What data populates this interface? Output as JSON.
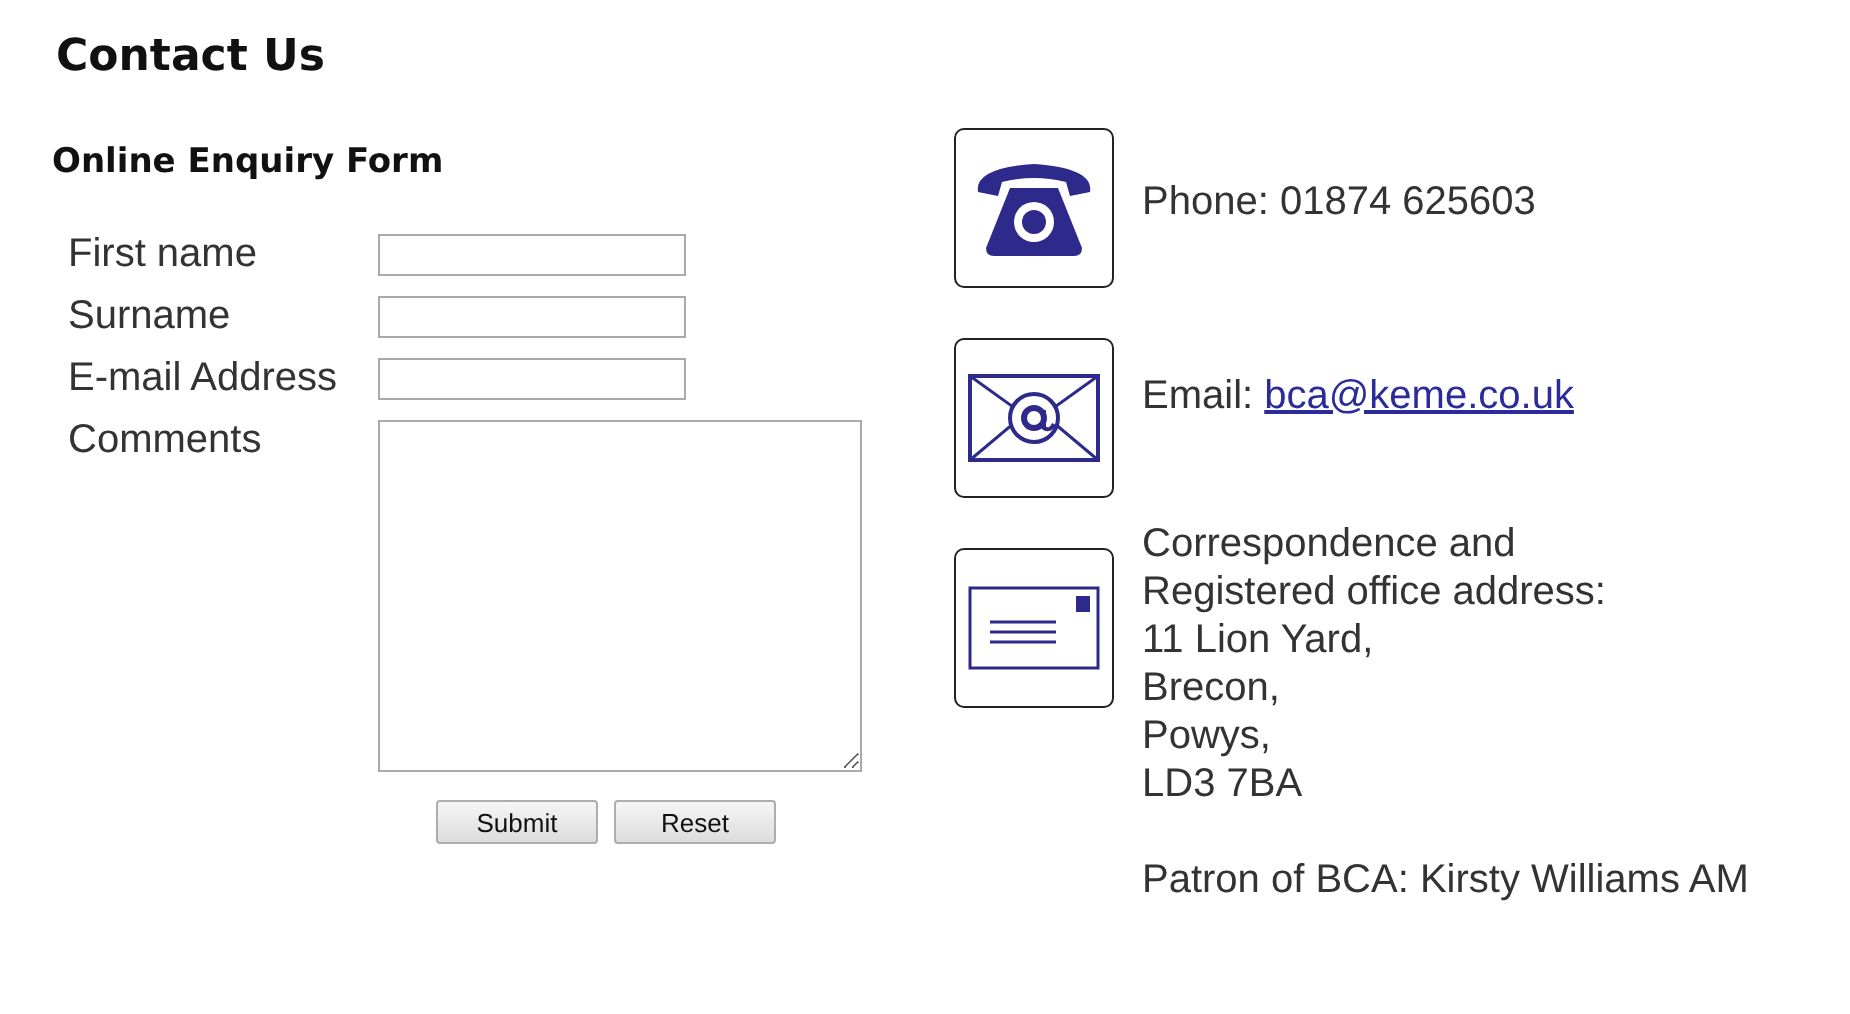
{
  "title": "Contact Us",
  "form": {
    "heading": "Online Enquiry Form",
    "fields": [
      {
        "label": "First name",
        "kind": "text"
      },
      {
        "label": "Surname",
        "kind": "text"
      },
      {
        "label": "E-mail Address",
        "kind": "text"
      },
      {
        "label": "Comments",
        "kind": "textarea"
      }
    ],
    "buttons": [
      "Submit",
      "Reset"
    ]
  },
  "contacts": [
    {
      "kind": "phone",
      "label": "Phone: 01874 625603"
    },
    {
      "kind": "email",
      "label": "Email: ",
      "link": "bca@keme.co.uk"
    },
    {
      "kind": "post",
      "lines": [
        "Correspondence and",
        "Registered office address:",
        "11 Lion Yard,",
        "Brecon,",
        "Powys,",
        "LD3 7BA"
      ]
    }
  ],
  "patron": "Patron of BCA: Kirsty Williams AM"
}
